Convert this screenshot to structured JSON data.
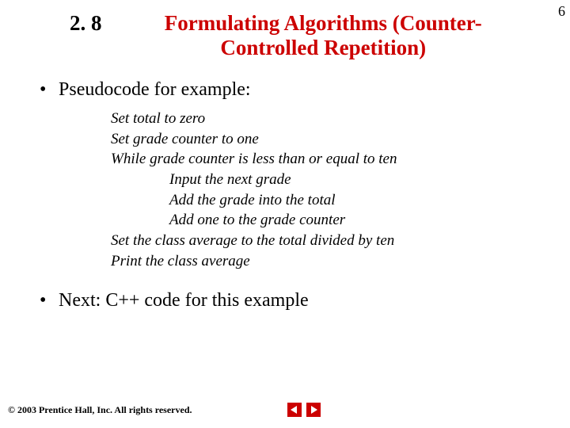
{
  "page_number": "6",
  "header": {
    "section_number": "2. 8",
    "title_line1": "Formulating Algorithms (Counter-",
    "title_line2": "Controlled Repetition)"
  },
  "bullets": {
    "item1": "Pseudocode for example:",
    "item2": "Next: C++ code for this example"
  },
  "pseudocode": {
    "l1": "Set total to zero",
    "l2": "Set grade counter to one",
    "l3": "While grade counter is less than or equal to ten",
    "l4": "Input the next grade",
    "l5": "Add the grade into the total",
    "l6": "Add one to the grade counter",
    "l7": "Set the class average to the total divided by ten",
    "l8": "Print the class average"
  },
  "footer": {
    "copyright": "© 2003 Prentice Hall, Inc. All rights reserved."
  }
}
